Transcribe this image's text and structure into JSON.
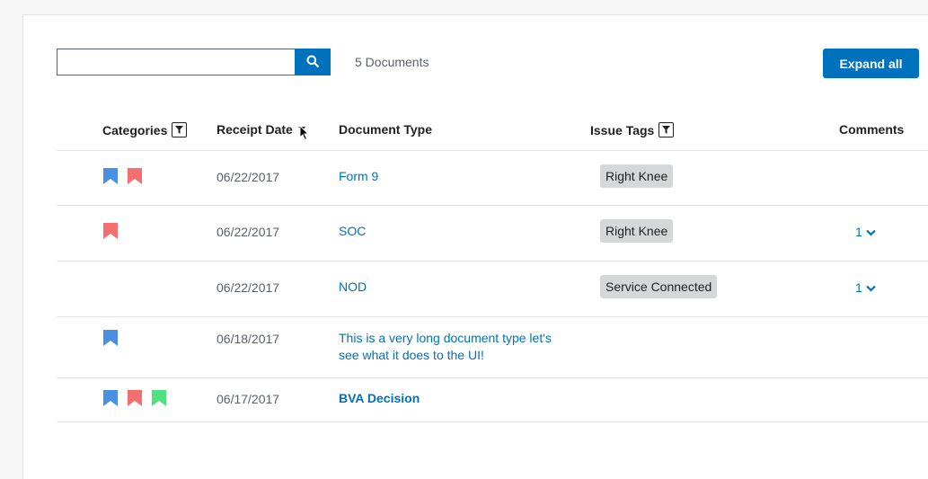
{
  "search": {
    "value": "",
    "placeholder": ""
  },
  "doc_count_label": "5 Documents",
  "expand_all_label": "Expand all",
  "columns": {
    "categories": "Categories",
    "receipt_date": "Receipt Date",
    "document_type": "Document Type",
    "issue_tags": "Issue Tags",
    "comments": "Comments"
  },
  "colors": {
    "primary": "#0071bc",
    "category_blue": "#4a90e2",
    "category_red": "#f36f6f",
    "category_green": "#4fe07f",
    "tag_bg": "#d6d7d9"
  },
  "rows": [
    {
      "categories": [
        "blue",
        "red"
      ],
      "date": "06/22/2017",
      "type": "Form 9",
      "type_bold": false,
      "tag": "Right Knee",
      "comments": ""
    },
    {
      "categories": [
        "red"
      ],
      "date": "06/22/2017",
      "type": "SOC",
      "type_bold": false,
      "tag": "Right Knee",
      "comments": "1"
    },
    {
      "categories": [],
      "date": "06/22/2017",
      "type": "NOD",
      "type_bold": false,
      "tag": "Service Connected",
      "comments": "1"
    },
    {
      "categories": [
        "blue"
      ],
      "date": "06/18/2017",
      "type": "This is a very long document type let's see what it does to the UI!",
      "type_bold": false,
      "tag": "",
      "comments": ""
    },
    {
      "categories": [
        "blue",
        "red",
        "green"
      ],
      "date": "06/17/2017",
      "type": "BVA Decision",
      "type_bold": true,
      "tag": "",
      "comments": ""
    }
  ]
}
